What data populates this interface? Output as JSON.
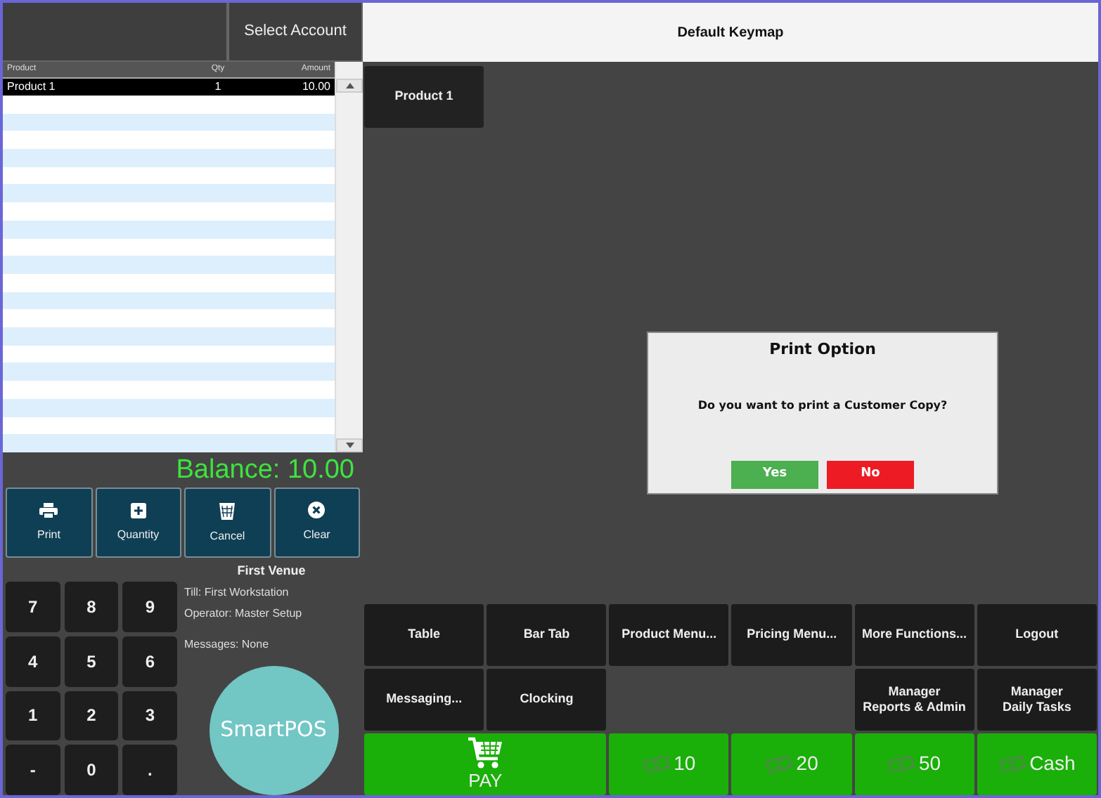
{
  "header": {
    "account_button": "Select Account",
    "keymap_title": "Default Keymap"
  },
  "ticket": {
    "columns": [
      "Product",
      "Qty",
      "Amount"
    ],
    "rows": [
      {
        "product": "Product 1",
        "qty": "1",
        "amount": "10.00",
        "selected": true
      }
    ]
  },
  "balance": "Balance: 10.00",
  "actions": [
    {
      "label": "Print",
      "kind": "print"
    },
    {
      "label": "Quantity",
      "kind": "quantity"
    },
    {
      "label": "Cancel",
      "kind": "cancel"
    },
    {
      "label": "Clear",
      "kind": "clear"
    }
  ],
  "venue": {
    "name": "First Venue",
    "till": "Till: First Workstation",
    "operator": "Operator: Master Setup",
    "messages": "Messages: None"
  },
  "keypad": [
    "7",
    "8",
    "9",
    "4",
    "5",
    "6",
    "1",
    "2",
    "3",
    "-",
    "0",
    "."
  ],
  "logo": "SmartPOS",
  "products": [
    {
      "label": "Product 1"
    }
  ],
  "function_keys": [
    {
      "label": "Table",
      "kind": "dark"
    },
    {
      "label": "Bar Tab",
      "kind": "dark"
    },
    {
      "label": "Product Menu...",
      "kind": "dark"
    },
    {
      "label": "Pricing Menu...",
      "kind": "dark"
    },
    {
      "label": "More Functions...",
      "kind": "dark"
    },
    {
      "label": "Logout",
      "kind": "dark"
    },
    {
      "label": "Messaging...",
      "kind": "dark"
    },
    {
      "label": "Clocking",
      "kind": "dark"
    },
    {
      "kind": "empty"
    },
    {
      "kind": "empty"
    },
    {
      "label": "Manager\nReports & Admin",
      "kind": "dark"
    },
    {
      "label": "Manager\nDaily Tasks",
      "kind": "dark"
    },
    {
      "label": "PAY",
      "kind": "pay"
    },
    {
      "label": "10",
      "kind": "cash"
    },
    {
      "label": "20",
      "kind": "cash"
    },
    {
      "label": "50",
      "kind": "cash"
    },
    {
      "label": "Cash",
      "kind": "cash"
    }
  ],
  "dialog": {
    "title": "Print Option",
    "message": "Do you want to print a Customer Copy?",
    "buttons": [
      {
        "label": "Yes",
        "kind": "confirm"
      },
      {
        "label": "No",
        "kind": "deny"
      }
    ]
  }
}
